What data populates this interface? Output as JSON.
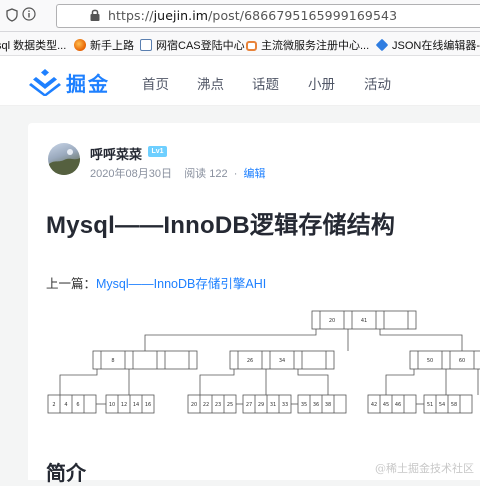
{
  "browser": {
    "url_prefix": "https://",
    "url_domain": "juejin.im",
    "url_path": "/post/6866795165999169543",
    "bookmarks": [
      {
        "label": "sql 数据类型...",
        "color": "#3a6bc4"
      },
      {
        "label": "新手上路",
        "color": "#e66000"
      },
      {
        "label": "网宿CAS登陆中心",
        "color": "#5a7fb0"
      },
      {
        "label": "主流微服务注册中心...",
        "color": "#e8833a"
      },
      {
        "label": "JSON在线编辑器-Be",
        "color": "#2f7de1"
      }
    ]
  },
  "nav": {
    "logo_text": "掘金",
    "items": [
      "首页",
      "沸点",
      "话题",
      "小册",
      "活动"
    ]
  },
  "article": {
    "author": "呼呼菜菜",
    "level": "Lv1",
    "date": "2020年08月30日",
    "reads_label": "阅读 122",
    "edit_label": "编辑",
    "title": "Mysql——InnoDB逻辑存储结构",
    "prev_label": "上一篇：",
    "prev_link": "Mysql——InnoDB存储引擎AHI",
    "section_heading": "简介"
  },
  "diagram": {
    "root": [
      "20",
      "41"
    ],
    "level2": [
      [
        "8"
      ],
      [
        "26",
        "34"
      ],
      [
        "50",
        "60"
      ]
    ],
    "leaves": [
      [
        "2",
        "4",
        "6"
      ],
      [
        "10",
        "12",
        "14",
        "16"
      ],
      [
        "20",
        "22",
        "23",
        "25"
      ],
      [
        "27",
        "29",
        "31",
        "33"
      ],
      [
        "35",
        "36",
        "38"
      ],
      [
        "42",
        "45",
        "46"
      ],
      [
        "51",
        "54",
        "58"
      ],
      [
        "61",
        "62",
        "65"
      ]
    ]
  },
  "watermark": "@稀土掘金技术社区"
}
